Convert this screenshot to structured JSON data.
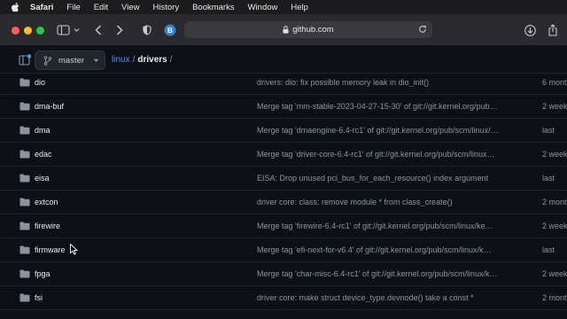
{
  "menubar": {
    "items": [
      "Safari",
      "File",
      "Edit",
      "View",
      "History",
      "Bookmarks",
      "Window",
      "Help"
    ]
  },
  "browser": {
    "url": "github.com",
    "extension_badge": "B"
  },
  "repo": {
    "branch": "master",
    "breadcrumb": [
      "linux",
      "drivers"
    ],
    "separator": "/"
  },
  "files": [
    {
      "name": "dio",
      "message": "drivers: dio: fix possible memory leak in dio_init()",
      "age": "6 mont"
    },
    {
      "name": "dma-buf",
      "message": "Merge tag 'mm-stable-2023-04-27-15-30' of git://git.kernel.org/pub…",
      "age": "2 week"
    },
    {
      "name": "dma",
      "message": "Merge tag 'dmaengine-6.4-rc1' of git://git.kernel.org/pub/scm/linux/…",
      "age": "last"
    },
    {
      "name": "edac",
      "message": "Merge tag 'driver-core-6.4-rc1' of git://git.kernel.org/pub/scm/linux…",
      "age": "2 week"
    },
    {
      "name": "eisa",
      "message": "EISA: Drop unused pci_bus_for_each_resource() index argument",
      "age": "last"
    },
    {
      "name": "extcon",
      "message": "driver core: class: remove module * from class_create()",
      "age": "2 mont"
    },
    {
      "name": "firewire",
      "message": "Merge tag 'firewire-6.4-rc1' of git://git.kernel.org/pub/scm/linux/ke…",
      "age": "2 week"
    },
    {
      "name": "firmware",
      "message": "Merge tag 'efi-next-for-v6.4' of git://git.kernel.org/pub/scm/linux/k…",
      "age": "last"
    },
    {
      "name": "fpga",
      "message": "Merge tag 'char-misc-6.4-rc1' of git://git.kernel.org/pub/scm/linux/k…",
      "age": "2 week"
    },
    {
      "name": "fsi",
      "message": "driver core: make struct device_type.devnode() take a const *",
      "age": "2 mont"
    }
  ],
  "colors": {
    "background": "#0d1117",
    "link": "#4493f8",
    "folder": "#8b949e",
    "muted_text": "#8b949e"
  }
}
